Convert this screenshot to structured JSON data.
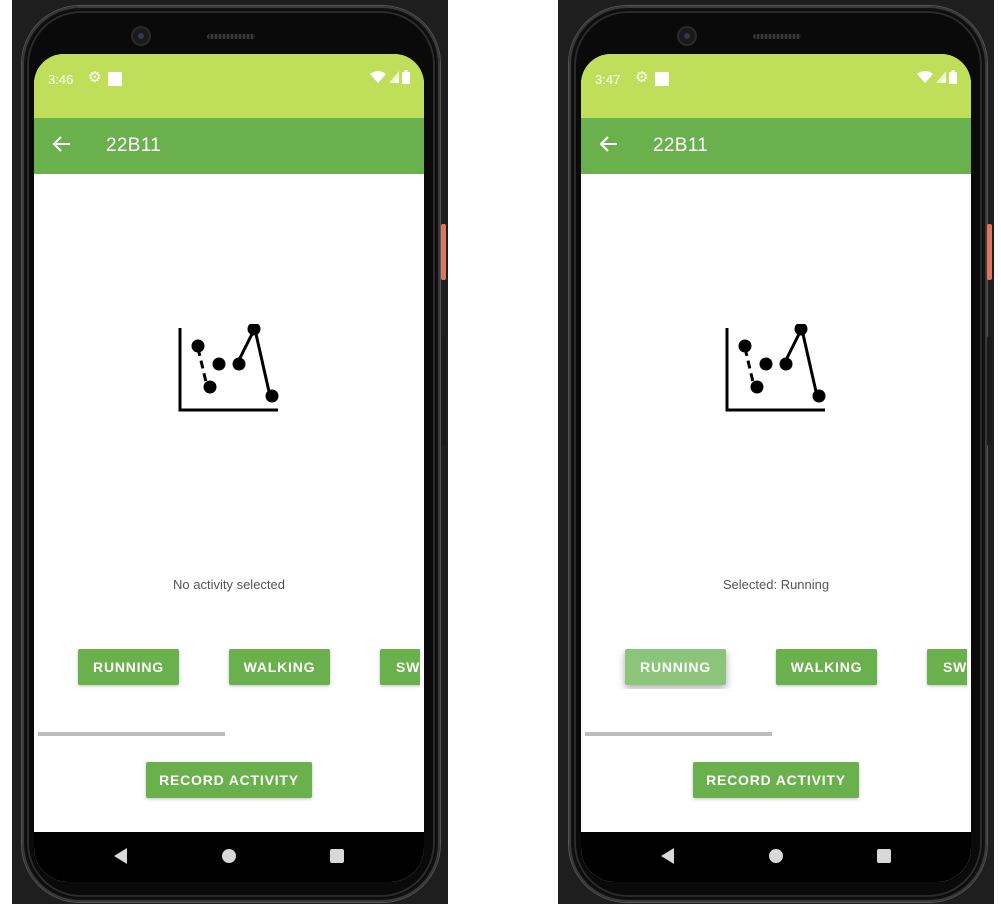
{
  "colors": {
    "status_bar": "#bfdf5b",
    "app_bar": "#6ab04c",
    "button": "#6ab04c",
    "button_pressed": "#8cc47a",
    "scroll_indicator": "#bdbdbd"
  },
  "devices": [
    {
      "status_bar": {
        "time": "3:46",
        "icons": [
          "gear-icon",
          "square-notification-icon",
          "wifi-icon",
          "signal-icon",
          "battery-icon"
        ]
      },
      "app_bar": {
        "back_icon": "arrow-left-icon",
        "title": "22B11"
      },
      "illustration": "scatter-chart-icon",
      "selection_text": "No activity selected",
      "activity_buttons": [
        {
          "label": "RUNNING",
          "state": "normal"
        },
        {
          "label": "WALKING",
          "state": "normal"
        },
        {
          "label": "SW",
          "state": "normal"
        }
      ],
      "record_button": "RECORD ACTIVITY",
      "nav_bar": [
        "back-triangle-icon",
        "home-circle-icon",
        "recents-square-icon"
      ]
    },
    {
      "status_bar": {
        "time": "3:47",
        "icons": [
          "gear-icon",
          "square-notification-icon",
          "wifi-icon",
          "signal-icon",
          "battery-icon"
        ]
      },
      "app_bar": {
        "back_icon": "arrow-left-icon",
        "title": "22B11"
      },
      "illustration": "scatter-chart-icon",
      "selection_text": "Selected: Running",
      "activity_buttons": [
        {
          "label": "RUNNING",
          "state": "pressed"
        },
        {
          "label": "WALKING",
          "state": "normal"
        },
        {
          "label": "SW",
          "state": "normal"
        }
      ],
      "record_button": "RECORD ACTIVITY",
      "nav_bar": [
        "back-triangle-icon",
        "home-circle-icon",
        "recents-square-icon"
      ]
    }
  ]
}
